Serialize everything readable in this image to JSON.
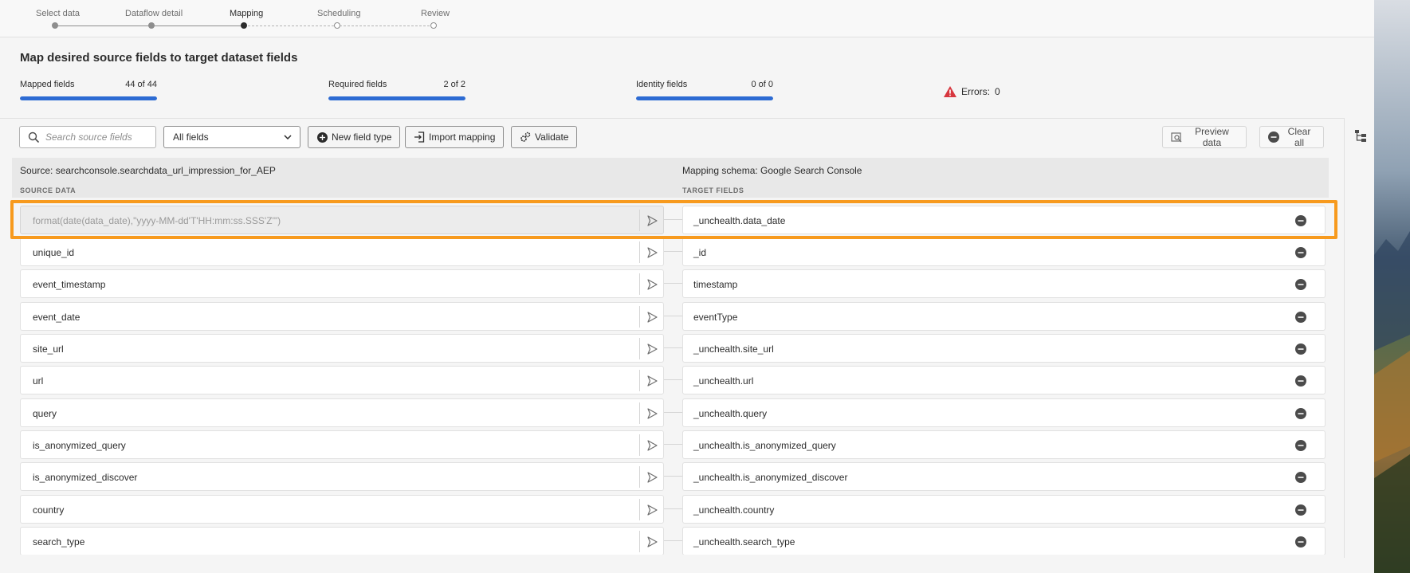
{
  "stepper": {
    "steps": [
      {
        "label": "Select data",
        "state": "done"
      },
      {
        "label": "Dataflow detail",
        "state": "done"
      },
      {
        "label": "Mapping",
        "state": "current"
      },
      {
        "label": "Scheduling",
        "state": "todo"
      },
      {
        "label": "Review",
        "state": "todo"
      }
    ]
  },
  "header": {
    "title": "Map desired source fields to target dataset fields",
    "meters": [
      {
        "label": "Mapped fields",
        "value": "44 of 44",
        "fill": 1.0
      },
      {
        "label": "Required fields",
        "value": "2 of 2",
        "fill": 1.0
      },
      {
        "label": "Identity fields",
        "value": "0 of 0",
        "fill": 1.0
      }
    ],
    "errors_label": "Errors:",
    "errors_count": "0"
  },
  "toolbar": {
    "search_placeholder": "Search source fields",
    "filter_value": "All fields",
    "new_field_type": "New field type",
    "import_mapping": "Import mapping",
    "validate": "Validate",
    "preview_data": "Preview data",
    "clear_all": "Clear all"
  },
  "mapping": {
    "source_title": "Source: searchconsole.searchdata_url_impression_for_AEP",
    "target_title": "Mapping schema: Google Search Console",
    "source_col": "SOURCE DATA",
    "target_col": "TARGET FIELDS",
    "rows": [
      {
        "source": "format(date(data_date),\"yyyy-MM-dd'T'HH:mm:ss.SSS'Z'\")",
        "target": "_unchealth.data_date"
      },
      {
        "source": "unique_id",
        "target": "_id"
      },
      {
        "source": "event_timestamp",
        "target": "timestamp"
      },
      {
        "source": "event_date",
        "target": "eventType"
      },
      {
        "source": "site_url",
        "target": "_unchealth.site_url"
      },
      {
        "source": "url",
        "target": "_unchealth.url"
      },
      {
        "source": "query",
        "target": "_unchealth.query"
      },
      {
        "source": "is_anonymized_query",
        "target": "_unchealth.is_anonymized_query"
      },
      {
        "source": "is_anonymized_discover",
        "target": "_unchealth.is_anonymized_discover"
      },
      {
        "source": "country",
        "target": "_unchealth.country"
      },
      {
        "source": "search_type",
        "target": "_unchealth.search_type"
      }
    ]
  },
  "colors": {
    "accent": "#2d6bd3",
    "highlight": "#f79a1e",
    "error": "#d7373f"
  }
}
